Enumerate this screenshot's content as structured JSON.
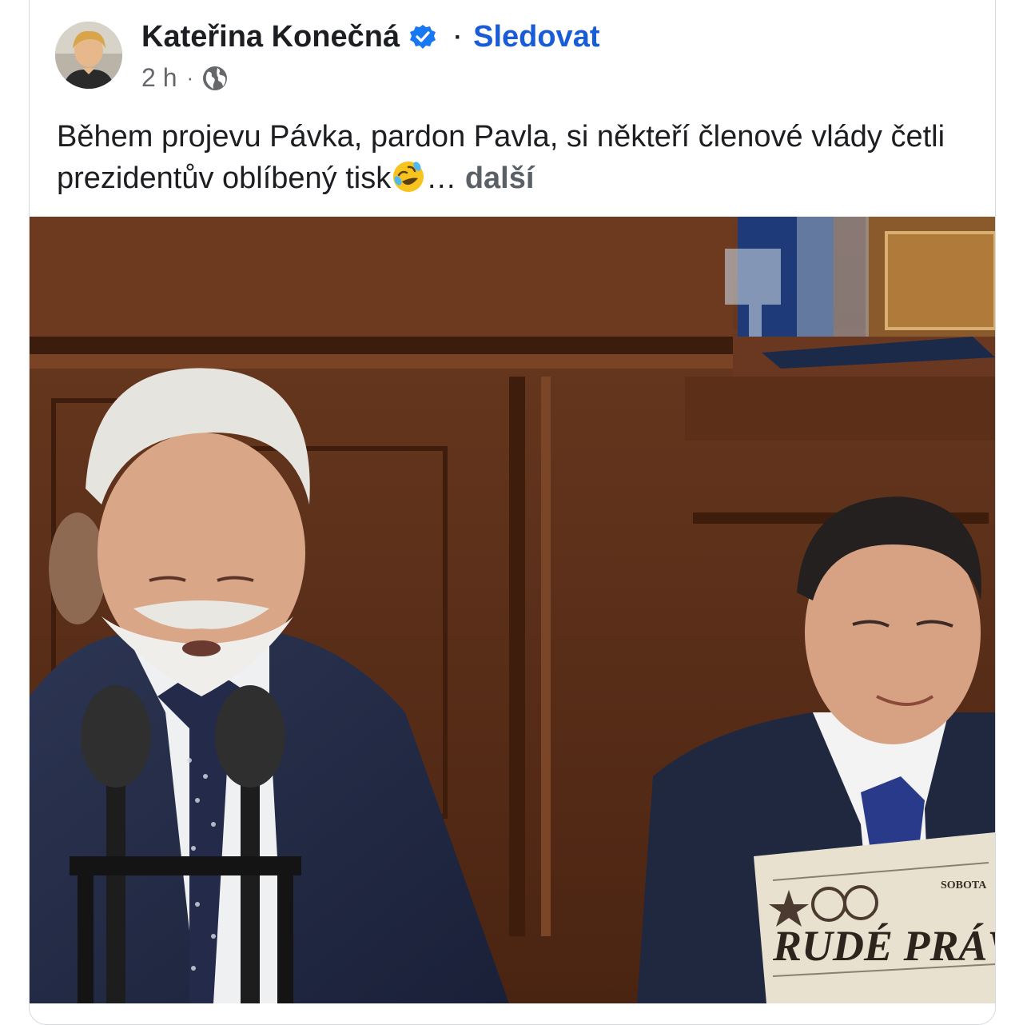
{
  "post": {
    "author_name": "Kateřina Konečná",
    "follow_label": "Sledovat",
    "separator": "·",
    "time": "2 h",
    "time_separator": "·",
    "text": "Během projevu Pávka, pardon Pavla, si někteří členové vlády četli prezidentův oblíbený tisk",
    "ellipsis": "…",
    "more_label": "další"
  },
  "image": {
    "newspaper_title": "RUDÉ PRÁVO",
    "newspaper_corner_text": "SOBOTA"
  },
  "icons": {
    "verified": "verified-badge-icon",
    "privacy": "globe-icon",
    "emoji": "rolling-on-floor-laughing-emoji"
  },
  "colors": {
    "link": "#1a5bd6",
    "verified": "#1877f2",
    "secondary_text": "#65676b"
  }
}
